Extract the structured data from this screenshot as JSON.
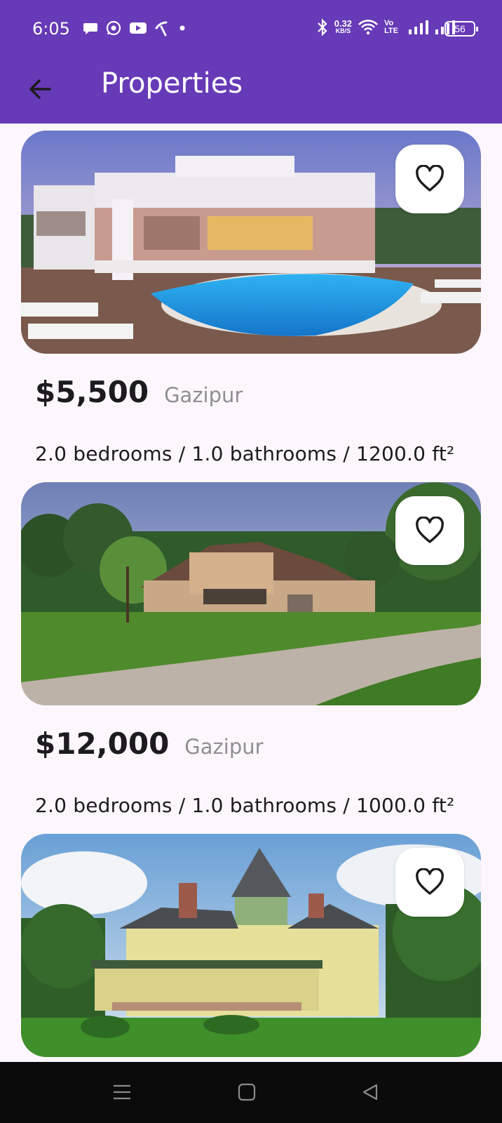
{
  "status_bar": {
    "time": "6:05",
    "net_speed_value": "0.32",
    "net_speed_unit": "KB/S",
    "volte": "Vo LTE",
    "battery": "56",
    "left_icons": [
      "chat-icon",
      "whatsapp-icon",
      "youtube-icon",
      "carrier-icon",
      "dot-icon"
    ],
    "right_icons": [
      "bluetooth-icon",
      "wifi-icon",
      "signal-icon",
      "signal-icon"
    ]
  },
  "app_bar": {
    "title": "Properties",
    "back_icon": "arrow-left-icon",
    "background": "#673ab7"
  },
  "properties": [
    {
      "price": "$5,500",
      "location": "Gazipur",
      "details": "2.0 bedrooms / 1.0 bathrooms / 1200.0 ft²",
      "favorite_icon": "heart-outline-icon"
    },
    {
      "price": "$12,000",
      "location": "Gazipur",
      "details": "2.0 bedrooms / 1.0 bathrooms / 1000.0 ft²",
      "favorite_icon": "heart-outline-icon"
    },
    {
      "price": "",
      "location": "",
      "details": "",
      "favorite_icon": "heart-outline-icon"
    }
  ],
  "nav_bar": {
    "icons": [
      "menu-icon",
      "home-square-icon",
      "back-triangle-icon"
    ]
  }
}
